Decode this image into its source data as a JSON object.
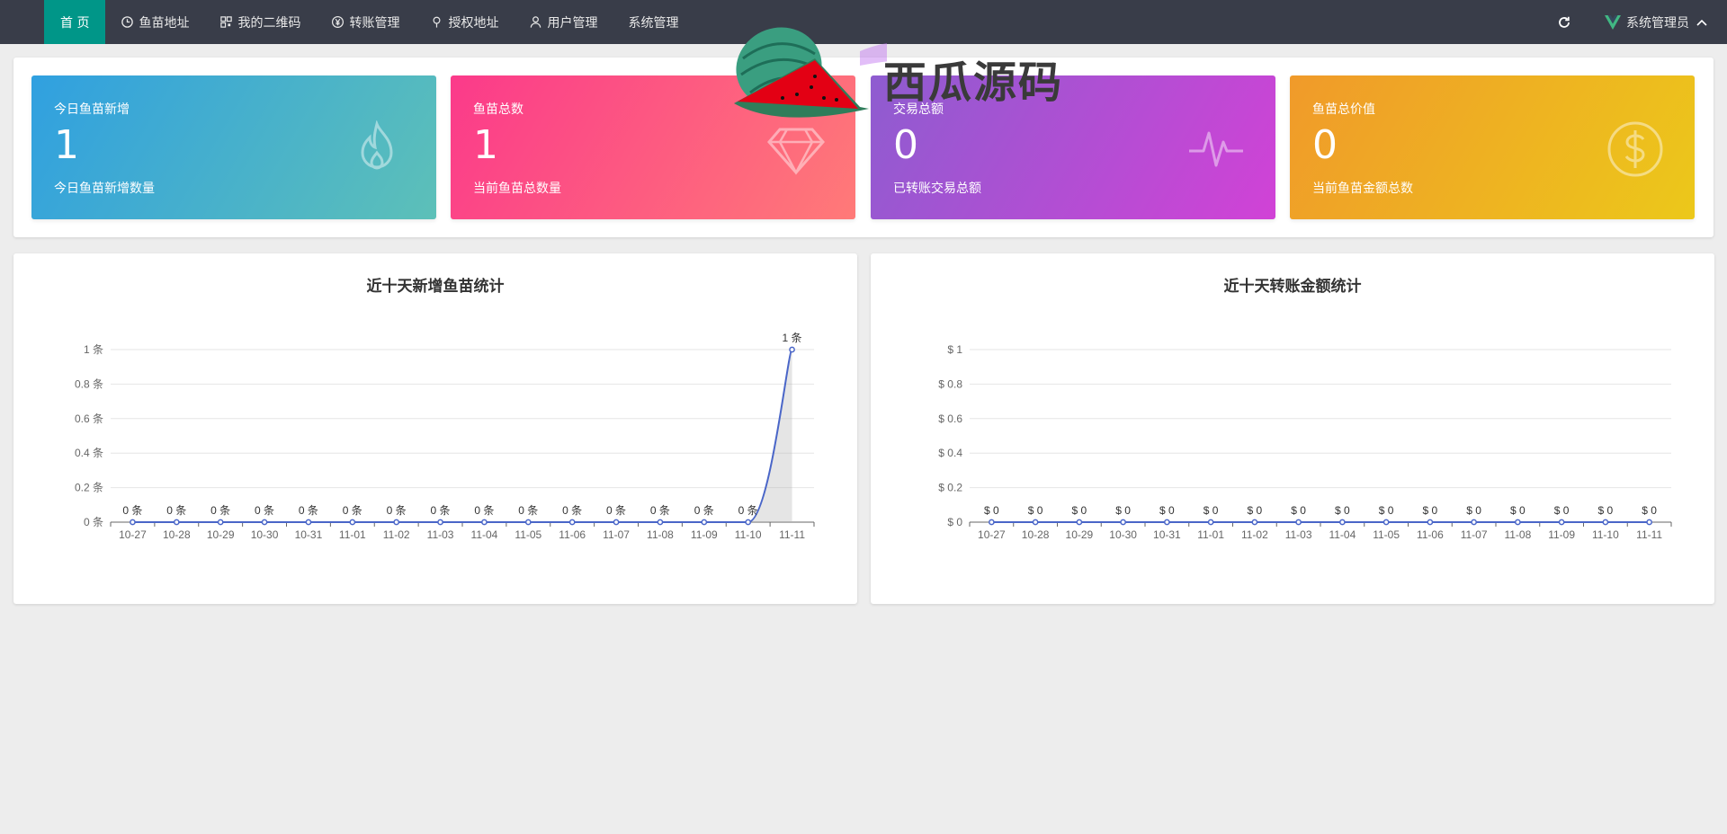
{
  "nav": {
    "items": [
      {
        "label": "首 页",
        "icon": "home",
        "active": true
      },
      {
        "label": "鱼苗地址",
        "icon": "clock-icon"
      },
      {
        "label": "我的二维码",
        "icon": "qrcode-icon"
      },
      {
        "label": "转账管理",
        "icon": "yen-icon"
      },
      {
        "label": "授权地址",
        "icon": "location-pin-icon"
      },
      {
        "label": "用户管理",
        "icon": "user-icon"
      },
      {
        "label": "系统管理",
        "icon": "none"
      }
    ],
    "refresh_icon": "refresh-icon",
    "user_label": "系统管理员",
    "user_logo": "vue-logo-icon",
    "user_chevron": "chevron-up-icon"
  },
  "watermark": {
    "text": "西瓜源码",
    "icon": "watermelon-icon"
  },
  "stats": [
    {
      "title": "今日鱼苗新增",
      "value": "1",
      "sub": "今日鱼苗新增数量",
      "icon": "flame-icon",
      "color": "#30a0e0"
    },
    {
      "title": "鱼苗总数",
      "value": "1",
      "sub": "当前鱼苗总数量",
      "icon": "diamond-icon",
      "color": "#fb3a8a"
    },
    {
      "title": "交易总额",
      "value": "0",
      "sub": "已转账交易总额",
      "icon": "heartbeat-icon",
      "color": "#b04fd4"
    },
    {
      "title": "鱼苗总价值",
      "value": "0",
      "sub": "当前鱼苗金额总数",
      "icon": "dollar-circle-icon",
      "color": "#f0a82a"
    }
  ],
  "chart_data": [
    {
      "type": "line",
      "title": "近十天新增鱼苗统计",
      "categories": [
        "10-27",
        "10-28",
        "10-29",
        "10-30",
        "10-31",
        "11-01",
        "11-02",
        "11-03",
        "11-04",
        "11-05",
        "11-06",
        "11-07",
        "11-08",
        "11-09",
        "11-10",
        "11-11"
      ],
      "values": [
        0,
        0,
        0,
        0,
        0,
        0,
        0,
        0,
        0,
        0,
        0,
        0,
        0,
        0,
        0,
        1
      ],
      "value_prefix": "",
      "value_suffix": " 条",
      "ylim": [
        0,
        1
      ],
      "yticks": [
        0,
        0.2,
        0.4,
        0.6,
        0.8,
        1
      ],
      "grid": true,
      "line_color": "#4a66c8"
    },
    {
      "type": "line",
      "title": "近十天转账金额统计",
      "categories": [
        "10-27",
        "10-28",
        "10-29",
        "10-30",
        "10-31",
        "11-01",
        "11-02",
        "11-03",
        "11-04",
        "11-05",
        "11-06",
        "11-07",
        "11-08",
        "11-09",
        "11-10",
        "11-11"
      ],
      "values": [
        0,
        0,
        0,
        0,
        0,
        0,
        0,
        0,
        0,
        0,
        0,
        0,
        0,
        0,
        0,
        0
      ],
      "value_prefix": "$ ",
      "value_suffix": "",
      "ylim": [
        0,
        1
      ],
      "yticks": [
        0,
        0.2,
        0.4,
        0.6,
        0.8,
        1
      ],
      "grid": true,
      "line_color": "#4a66c8"
    }
  ]
}
